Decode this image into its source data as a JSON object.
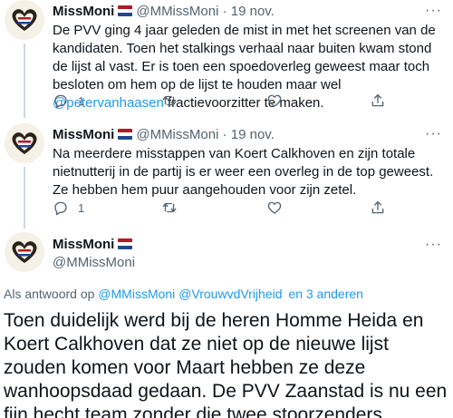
{
  "tweets": [
    {
      "name": "MissMoni",
      "handle": "@MMissMoni",
      "sep": "·",
      "date": "19 nov.",
      "text_before": "De PVV ging 4 jaar geleden de mist in met het screenen van de kandidaten. Toen het stalkings verhaal naar buiten kwam stond de lijst al vast. Er is toen een spoedoverleg geweest maar toch besloten om hem op de lijst te houden maar wel ",
      "mention": "@petervanhaasen",
      "text_after": " fractievoorzitter te maken.",
      "reply_count": "1",
      "more": "···"
    },
    {
      "name": "MissMoni",
      "handle": "@MMissMoni",
      "sep": "·",
      "date": "19 nov.",
      "text": "Na meerdere misstappen van Koert Calkhoven en zijn totale nietnutterij in de partij is er weer een overleg in de top geweest. Ze hebben hem puur aangehouden voor zijn zetel.",
      "reply_count": "1",
      "more": "···"
    }
  ],
  "main": {
    "name": "MissMoni",
    "handle": "@MMissMoni",
    "more": "···",
    "reply_prefix": "Als antwoord op",
    "reply_mention_1": "@MMissMoni",
    "reply_mention_2": "@VrouwvdVrijheid",
    "reply_and": "en 3 anderen",
    "text": "Toen duidelijk werd bij de heren Homme Heida en Koert Calkhoven dat ze niet op de nieuwe lijst zouden komen voor Maart hebben ze deze wanhoopsdaad gedaan. De PVV Zaanstad is nu een fijn hecht team zonder die twee stoorzenders."
  },
  "colors": {
    "link": "#1d9bf0",
    "muted": "#536471",
    "flag_red": "#ae1c28",
    "flag_white": "#ffffff",
    "flag_blue": "#21468b"
  },
  "icons": [
    "avatar-heart-hands",
    "nl-flag-icon",
    "reply-icon",
    "retweet-icon",
    "like-icon",
    "share-icon",
    "more-icon"
  ]
}
